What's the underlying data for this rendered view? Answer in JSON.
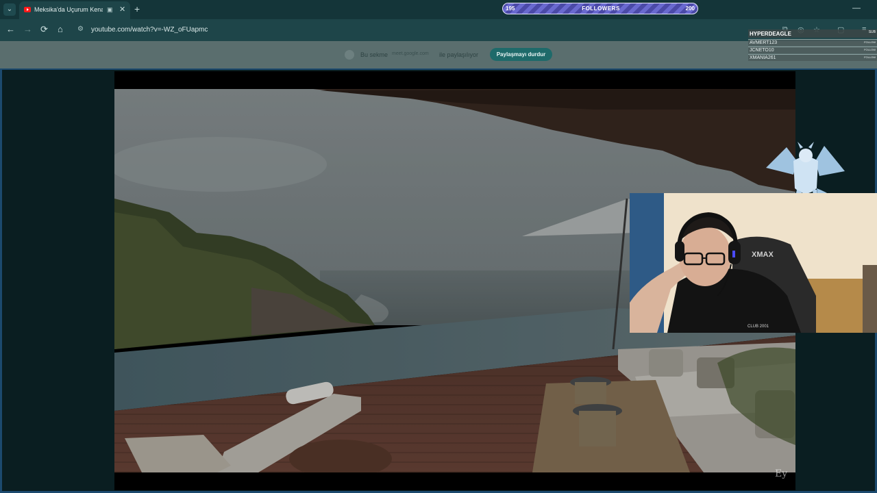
{
  "browser": {
    "tab": {
      "title": "Meksika'da Uçurum Kenarı",
      "close": "✕",
      "new_tab": "+",
      "list_button": "⌄"
    },
    "window": {
      "minimize": "—"
    },
    "nav": {
      "back": "←",
      "forward": "→",
      "reload": "⟳",
      "home": "⌂"
    },
    "url": "youtube.com/watch?v=-WZ_oFUapmc"
  },
  "share_bar": {
    "prefix": "Bu sekme",
    "domain": "meet.google.com",
    "suffix": "ile paylaşılıyor",
    "button": "Paylaşmayı durdur"
  },
  "followers_bar": {
    "current": "195",
    "label": "FOLLOWERS",
    "goal": "200",
    "progress_fraction": 0.975,
    "colors": {
      "stripe_dark": "#4b4aa8",
      "stripe_light": "#6a6ad0"
    }
  },
  "sub_list": {
    "header": {
      "name": "HYPERDEAGLE",
      "tag": "SUB"
    },
    "rows": [
      {
        "name": "AVMERT123",
        "tag": "FOLLOW"
      },
      {
        "name": "JCNETO10",
        "tag": "FOLLOW"
      },
      {
        "name": "XMANIA261",
        "tag": "FOLLOW"
      }
    ]
  },
  "video": {
    "watermark": "Ey"
  },
  "webcam": {
    "chair_brand": "XMAX",
    "shirt_text": "CLUB 2001"
  },
  "colors": {
    "tabbar": "#143539",
    "toolbar": "#1e4549",
    "share_bar": "#5a6e6e",
    "share_button": "#1e6a6a",
    "stage_border": "#1c4a6e",
    "youtube_red": "#ff1a1a"
  }
}
